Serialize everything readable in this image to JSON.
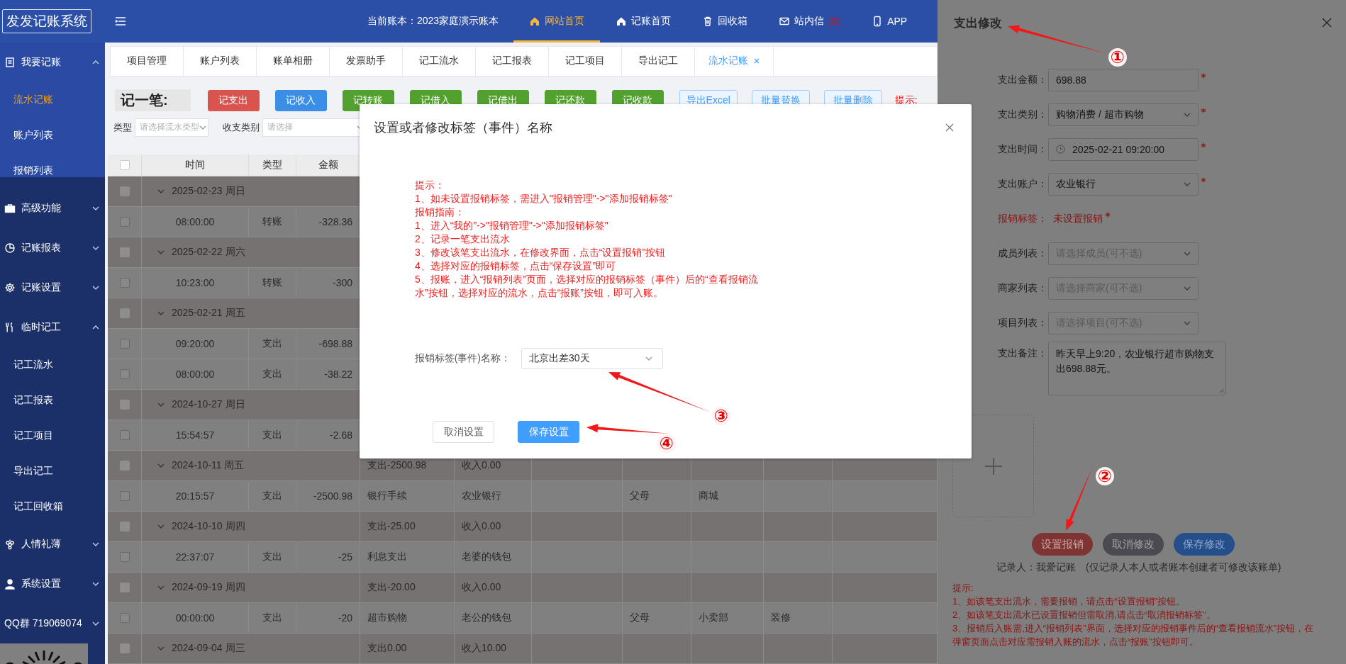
{
  "app": {
    "logo": "发发记账系统"
  },
  "topbar": {
    "account_label": "当前账本：2023家庭演示账本",
    "nav": [
      {
        "label": "网站首页",
        "selected": true
      },
      {
        "label": "记账首页",
        "selected": false
      },
      {
        "label": "回收箱",
        "selected": false
      },
      {
        "label": "站内信",
        "badge": "(0)",
        "selected": false
      },
      {
        "label": "APP",
        "selected": false
      }
    ]
  },
  "sidebar": {
    "groups": [
      {
        "label": "我要记账",
        "expanded": true,
        "children": [
          {
            "label": "流水记账",
            "selected": true
          },
          {
            "label": "账户列表",
            "selected": false
          },
          {
            "label": "报销列表",
            "selected": false
          }
        ]
      },
      {
        "label": "高级功能",
        "expanded": false
      },
      {
        "label": "记账报表",
        "expanded": false
      },
      {
        "label": "记账设置",
        "expanded": false
      },
      {
        "label": "临时记工",
        "expanded": true,
        "children": [
          {
            "label": "记工流水",
            "selected": false
          },
          {
            "label": "记工报表",
            "selected": false
          },
          {
            "label": "记工项目",
            "selected": false
          },
          {
            "label": "导出记工",
            "selected": false
          },
          {
            "label": "记工回收箱",
            "selected": false
          }
        ]
      },
      {
        "label": "人情礼薄",
        "expanded": false
      },
      {
        "label": "系统设置",
        "expanded": false
      },
      {
        "label": "QQ群 719069074",
        "expanded": false
      }
    ]
  },
  "tabs": [
    {
      "label": "项目管理",
      "selected": false
    },
    {
      "label": "账户列表",
      "selected": false
    },
    {
      "label": "账单相册",
      "selected": false
    },
    {
      "label": "发票助手",
      "selected": false
    },
    {
      "label": "记工流水",
      "selected": false
    },
    {
      "label": "记工报表",
      "selected": false
    },
    {
      "label": "记工项目",
      "selected": false
    },
    {
      "label": "导出记工",
      "selected": false
    },
    {
      "label": "流水记账",
      "selected": true,
      "closable": true
    }
  ],
  "toolbar": {
    "title": "记一笔:",
    "hint": "提示:",
    "buttons": [
      {
        "label": "记支出",
        "kind": "danger"
      },
      {
        "label": "记收入",
        "kind": "primary"
      },
      {
        "label": "记转账",
        "kind": "success"
      },
      {
        "label": "记借入",
        "kind": "success"
      },
      {
        "label": "记借出",
        "kind": "success"
      },
      {
        "label": "记还款",
        "kind": "success"
      },
      {
        "label": "记收款",
        "kind": "success"
      },
      {
        "label": "导出Excel",
        "kind": "plain"
      },
      {
        "label": "批量替换",
        "kind": "plain"
      },
      {
        "label": "批量删除",
        "kind": "plain"
      }
    ]
  },
  "filters": [
    {
      "label": "类型",
      "placeholder": "请选择流水类型"
    },
    {
      "label": "收支类别",
      "placeholder": "请选择"
    }
  ],
  "table": {
    "select_all": {
      "checked": false
    },
    "columns": [
      "时间",
      "类型",
      "金额"
    ],
    "rows": [
      {
        "kind": "group",
        "date": "2025-02-23 周日",
        "expanded": true,
        "checked": false
      },
      {
        "kind": "entry",
        "time": "08:00:00",
        "type": "转账",
        "amount": "-328.36",
        "checked": false
      },
      {
        "kind": "group",
        "date": "2025-02-22 周六",
        "expanded": true,
        "checked": false
      },
      {
        "kind": "entry",
        "time": "10:23:00",
        "type": "转账",
        "amount": "-300",
        "checked": false
      },
      {
        "kind": "group",
        "date": "2025-02-21 周五",
        "expanded": true,
        "checked": false
      },
      {
        "kind": "entry",
        "time": "09:20:00",
        "type": "支出",
        "amount": "-698.88",
        "checked": false
      },
      {
        "kind": "entry",
        "time": "08:00:00",
        "type": "支出",
        "amount": "-38.22",
        "checked": false
      },
      {
        "kind": "group",
        "date": "2024-10-27 周日",
        "expanded": true,
        "checked": false
      },
      {
        "kind": "entry",
        "time": "15:54:57",
        "type": "支出",
        "amount": "-2.68",
        "checked": false
      },
      {
        "kind": "group",
        "date": "2024-10-11 周五",
        "expanded": true,
        "checked": false,
        "column_4": "支出-2500.98",
        "column_5": "收入0.00"
      },
      {
        "kind": "entry",
        "time": "20:15:57",
        "type": "支出",
        "amount": "-2500.98",
        "checked": false,
        "column_4": "银行手续",
        "column_5": "农业银行",
        "column_7": "父母",
        "column_8": "商城"
      },
      {
        "kind": "group",
        "date": "2024-10-10 周四",
        "expanded": true,
        "checked": false,
        "column_4": "支出-25.00",
        "column_5": "收入0.00"
      },
      {
        "kind": "entry",
        "time": "22:37:07",
        "type": "支出",
        "amount": "-25",
        "checked": false,
        "column_4": "利息支出",
        "column_5": "老婆的钱包"
      },
      {
        "kind": "group",
        "date": "2024-09-19 周四",
        "expanded": true,
        "checked": false,
        "column_4": "支出-20.00",
        "column_5": "收入0.00"
      },
      {
        "kind": "entry",
        "time": "00:00:00",
        "type": "支出",
        "amount": "-20",
        "checked": false,
        "column_4": "超市购物",
        "column_5": "老公的钱包",
        "column_7": "父母",
        "column_8": "小卖部",
        "column_9": "装修"
      },
      {
        "kind": "group",
        "date": "2024-09-04 周三",
        "expanded": true,
        "checked": false,
        "column_4": "支出0.00",
        "column_5": "收入10.00"
      }
    ]
  },
  "drawer": {
    "title": "支出修改",
    "fields": [
      {
        "kind": "input",
        "label": "支出金额：",
        "value": "698.88",
        "required": true
      },
      {
        "kind": "select",
        "label": "支出类别：",
        "value": "购物消费 / 超市购物",
        "required": true
      },
      {
        "kind": "datetime",
        "label": "支出时间：",
        "value": "2025-02-21 09:20:00",
        "required": true
      },
      {
        "kind": "select",
        "label": "支出账户：",
        "value": "农业银行",
        "required": true
      },
      {
        "kind": "tag",
        "label": "报销标签：",
        "value": "未设置报销",
        "required": true
      },
      {
        "kind": "select",
        "label": "成员列表：",
        "placeholder": "请选择成员(可不选)",
        "required": false
      },
      {
        "kind": "select",
        "label": "商家列表：",
        "placeholder": "请选择商家(可不选)",
        "required": false
      },
      {
        "kind": "select",
        "label": "项目列表：",
        "placeholder": "请选择项目(可不选)",
        "required": false
      },
      {
        "kind": "textarea",
        "label": "支出备注：",
        "value": "昨天早上9:20，农业银行超市购物支出698.88元。",
        "required": false
      }
    ],
    "buttons": [
      {
        "label": "设置报销",
        "kind": "danger"
      },
      {
        "label": "取消修改",
        "kind": "dark"
      },
      {
        "label": "保存修改",
        "kind": "primary"
      }
    ],
    "recorder": "记录人：我爱记账",
    "recorder_note": "(仅记录人本人或者账本创建者可修改该账单)",
    "tips": [
      "提示:",
      "1、如该笔支出流水，需要报销，请点击“设置报销”按钮。",
      "2、如该笔支出流水已设置报销但需取消,请点击“取消报销标签”。",
      "3、报销后入账需,进入“报销列表”界面，选择对应的报销事件后的“查看报销流水”按钮，在弹窗页面点击对应需报销入账的流水，点击“报账”按钮即可。"
    ]
  },
  "dialog": {
    "title": "设置或者修改标签（事件）名称",
    "tips": [
      "提示：",
      "1、如未设置报销标签，需进入\"报销管理\"->\"添加报销标签\"",
      "报销指南：",
      "1、进入“我的”->\"报销管理\"->\"添加报销标签\"",
      "2、记录一笔支出流水",
      "3、修改该笔支出流水，在修改界面，点击“设置报销”按钮",
      "4、选择对应的报销标签，点击“保存设置”即可",
      "5、报账，进入“报销列表”页面，选择对应的报销标签（事件）后的“查看报销流水”按钮，选择对应的流水，点击“报账”按钮，即可入账。"
    ],
    "field": {
      "label": "报销标签(事件)名称：",
      "value": "北京出差30天"
    },
    "buttons": [
      {
        "label": "取消设置",
        "kind": "plain"
      },
      {
        "label": "保存设置",
        "kind": "primary"
      }
    ]
  },
  "annotations": [
    {
      "label": "①"
    },
    {
      "label": "②"
    },
    {
      "label": "③"
    },
    {
      "label": "④"
    }
  ]
}
